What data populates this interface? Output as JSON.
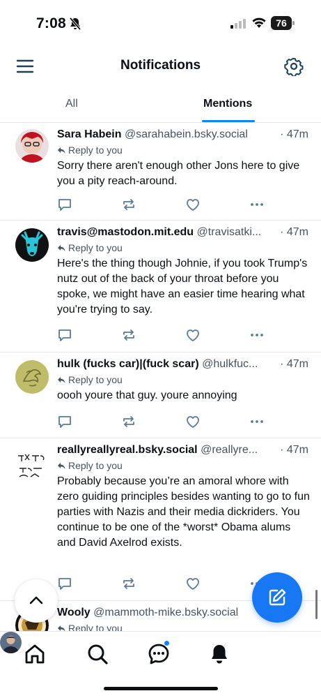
{
  "status_bar": {
    "time": "7:08",
    "battery": "76"
  },
  "header": {
    "title": "Notifications",
    "menu_icon": "hamburger-icon",
    "settings_icon": "gear-icon"
  },
  "tabs": [
    {
      "label": "All",
      "active": false
    },
    {
      "label": "Mentions",
      "active": true
    }
  ],
  "colors": {
    "accent": "#1083fe",
    "fab": "#1877f2",
    "muted": "#47525e",
    "divider": "#e3e8ee"
  },
  "posts": [
    {
      "author": "Sara Habein",
      "handle": "@sarahabein.bsky.social",
      "time": "47m",
      "reply_label": "Reply to you",
      "text": "Sorry there aren't enough other Jons here to give you a pity reach-around."
    },
    {
      "author": "travis@mastodon.mit.edu",
      "handle": "@travisatki...",
      "time": "47m",
      "reply_label": "Reply to you",
      "text": "Here's the thing though Johnie, if you took Trump's nutz out of the back of your throat before you spoke, we might have an easier time hearing what you're trying to say."
    },
    {
      "author": "hulk (fucks car)|(fuck scar)",
      "handle": "@hulkfuc...",
      "time": "47m",
      "reply_label": "Reply to you",
      "text": "oooh youre that guy. youre annoying"
    },
    {
      "author": "reallyreallyreal.bsky.social",
      "handle": "@reallyre...",
      "time": "47m",
      "reply_label": "Reply to you",
      "text": "Probably because you’re an amoral whore with zero guiding principles besides wanting to go to fun parties with Nazis and their media dickriders. You continue to be one of the *worst* Obama alums and David Axelrod exists."
    },
    {
      "author": "Wooly",
      "handle": "@mammoth-mike.bsky.social",
      "time": "",
      "reply_label": "Reply to you",
      "text": ""
    }
  ],
  "nav": [
    "home-icon",
    "search-icon",
    "chat-icon",
    "bell-icon",
    "profile-avatar"
  ]
}
